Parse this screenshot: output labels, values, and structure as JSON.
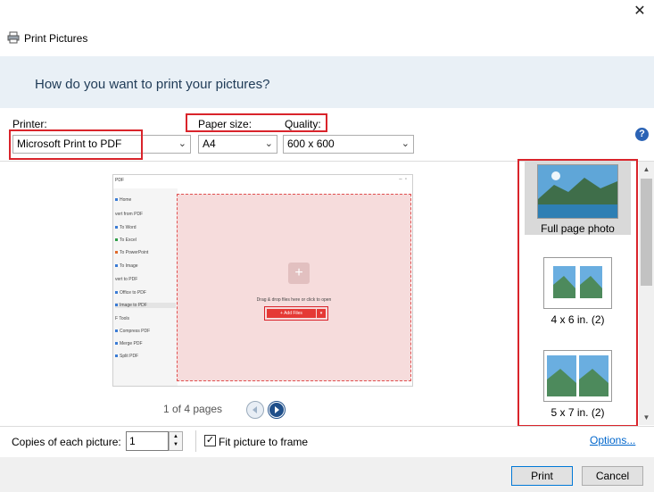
{
  "window": {
    "title": "Print Pictures",
    "close_glyph": "✕",
    "heading": "How do you want to print your pictures?"
  },
  "printer": {
    "label": "Printer:",
    "value": "Microsoft Print to PDF"
  },
  "paper_size": {
    "label": "Paper size:",
    "value": "A4"
  },
  "quality": {
    "label": "Quality:",
    "value": "600 x 600"
  },
  "help_glyph": "?",
  "preview": {
    "app_title": "PDF",
    "sidebar_items": [
      "Home",
      "vert from PDF",
      "To Word",
      "To Excel",
      "To PowerPoint",
      "To Image",
      "vert to PDF",
      "Office to PDF",
      "Image to PDF",
      "F Tools",
      "Compress PDF",
      "Merge PDF",
      "Split PDF"
    ],
    "drop_text": "Drag & drop files here or click to open",
    "add_files": "+ Add Files",
    "plus": "+"
  },
  "pager": {
    "text": "1 of 4 pages"
  },
  "layouts": [
    {
      "label": "Full page photo",
      "selected": true
    },
    {
      "label": "4 x 6 in. (2)",
      "selected": false
    },
    {
      "label": "5 x 7 in. (2)",
      "selected": false
    }
  ],
  "copies": {
    "label": "Copies of each picture:",
    "value": "1"
  },
  "fit": {
    "label": "Fit picture to frame",
    "checked": true
  },
  "options_link": "Options...",
  "buttons": {
    "print": "Print",
    "cancel": "Cancel"
  },
  "colors": {
    "highlight_red": "#d9242b",
    "banner_bg": "#e9f0f6",
    "accent_blue": "#0078d7"
  }
}
